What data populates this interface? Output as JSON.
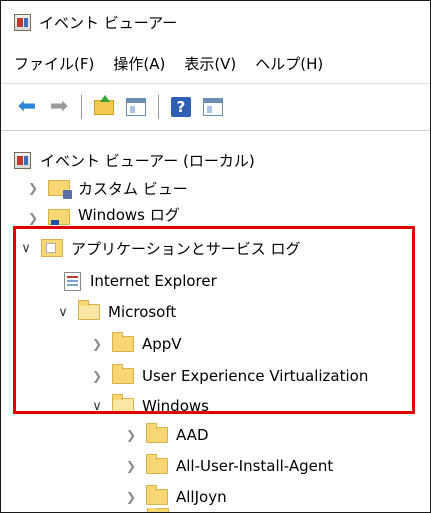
{
  "window": {
    "title": "イベント ビューアー"
  },
  "menu": [
    {
      "label": "ファイル(F)"
    },
    {
      "label": "操作(A)"
    },
    {
      "label": "表示(V)"
    },
    {
      "label": "ヘルプ(H)"
    }
  ],
  "toolbar": {
    "buttons": [
      "back-arrow-icon",
      "forward-arrow-icon",
      "folder-up-icon",
      "show-hide-console-tree-icon",
      "help-icon",
      "show-hide-action-pane-icon"
    ]
  },
  "tree": {
    "root": "イベント ビューアー (ローカル)",
    "custom_views": "カスタム ビュー",
    "windows_logs": "Windows ログ",
    "app_service_logs": "アプリケーションとサービス ログ",
    "internet_explorer": "Internet Explorer",
    "microsoft": "Microsoft",
    "appv": "AppV",
    "uev": "User Experience Virtualization",
    "windows": "Windows",
    "aad": "AAD",
    "all_user_install_agent": "All-User-Install-Agent",
    "alljoyn": "AllJoyn"
  },
  "colors": {
    "highlight_border": "#e00000",
    "back_arrow": "#2e86d6"
  }
}
